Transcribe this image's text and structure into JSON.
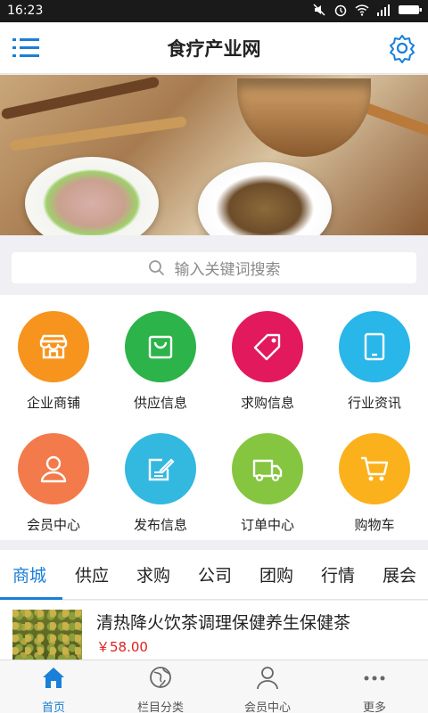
{
  "statusbar": {
    "time": "16:23"
  },
  "appbar": {
    "title": "食疗产业网",
    "menu_icon": "menu-icon",
    "settings_icon": "gear-icon"
  },
  "banner": {
    "slides": 2,
    "active": 0
  },
  "search": {
    "placeholder": "输入关键词搜索"
  },
  "grid": {
    "items": [
      {
        "label": "企业商铺",
        "color": "#f7941d",
        "icon": "store-icon"
      },
      {
        "label": "供应信息",
        "color": "#2cb34a",
        "icon": "bag-icon"
      },
      {
        "label": "求购信息",
        "color": "#e2195c",
        "icon": "tag-icon"
      },
      {
        "label": "行业资讯",
        "color": "#29b6e8",
        "icon": "tablet-icon"
      },
      {
        "label": "会员中心",
        "color": "#f37a4a",
        "icon": "user-icon"
      },
      {
        "label": "发布信息",
        "color": "#33b8e0",
        "icon": "edit-icon"
      },
      {
        "label": "订单中心",
        "color": "#86c540",
        "icon": "truck-icon"
      },
      {
        "label": "购物车",
        "color": "#fbb11c",
        "icon": "cart-icon"
      }
    ]
  },
  "tabs": {
    "items": [
      "商城",
      "供应",
      "求购",
      "公司",
      "团购",
      "行情",
      "展会"
    ],
    "active": 0
  },
  "product": {
    "title": "清热降火饮茶调理保健养生保健茶",
    "price": "￥58.00"
  },
  "bottomnav": {
    "items": [
      {
        "label": "首页",
        "icon": "home-icon"
      },
      {
        "label": "栏目分类",
        "icon": "globe-icon"
      },
      {
        "label": "会员中心",
        "icon": "user-icon"
      },
      {
        "label": "更多",
        "icon": "more-icon"
      }
    ],
    "active": 0
  },
  "colors": {
    "accent": "#1a7fd8",
    "price": "#e02020"
  }
}
